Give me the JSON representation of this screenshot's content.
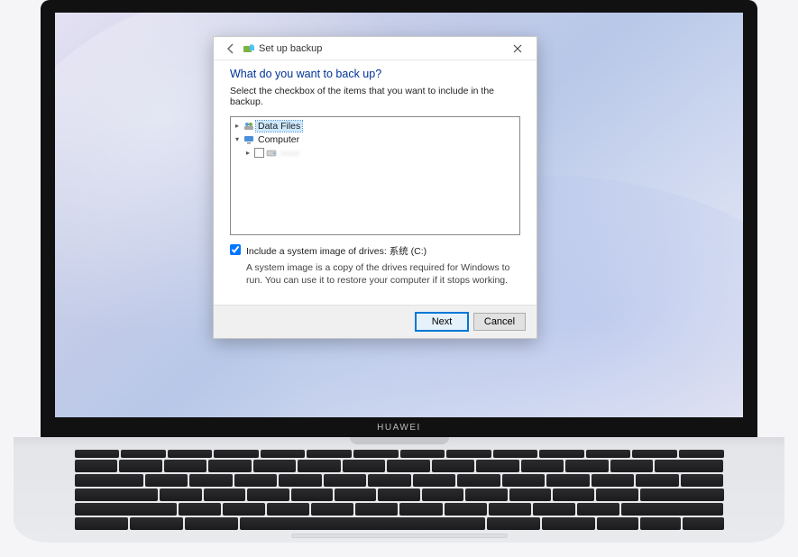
{
  "laptop_brand": "HUAWEI",
  "dialog": {
    "title": "Set up backup",
    "heading": "What do you want to back up?",
    "instruction": "Select the checkbox of the items that you want to include in the backup.",
    "tree": {
      "data_files": "Data Files",
      "computer": "Computer",
      "drive_redacted": "——"
    },
    "system_image": {
      "checkbox_label": "Include a system image of drives: 系统 (C:)",
      "description": "A system image is a copy of the drives required for Windows to run. You can use it to restore your computer if it stops working."
    },
    "buttons": {
      "next": "Next",
      "cancel": "Cancel"
    }
  }
}
